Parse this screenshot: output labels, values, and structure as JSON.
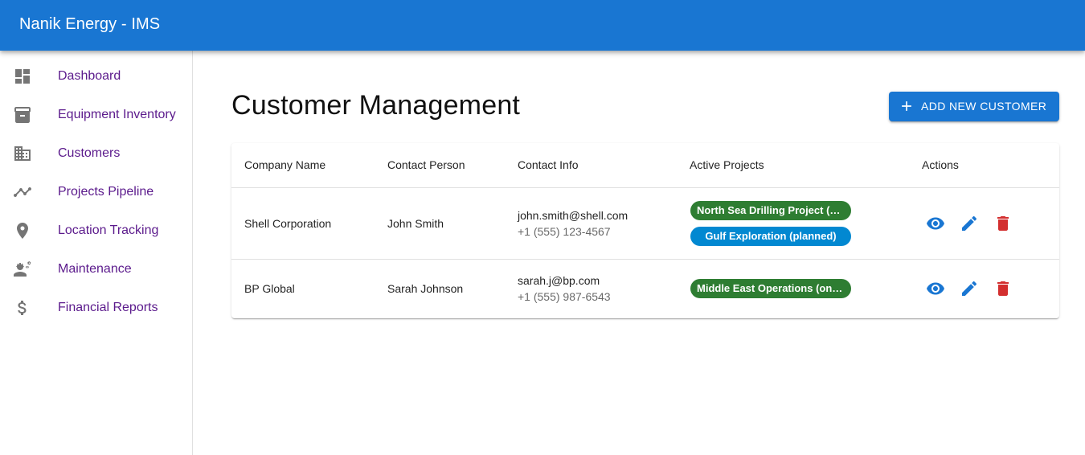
{
  "app": {
    "title": "Nanik Energy - IMS"
  },
  "sidebar": {
    "items": [
      {
        "label": "Dashboard",
        "icon": "dashboard-icon"
      },
      {
        "label": "Equipment Inventory",
        "icon": "inventory-icon"
      },
      {
        "label": "Customers",
        "icon": "business-icon"
      },
      {
        "label": "Projects Pipeline",
        "icon": "timeline-icon"
      },
      {
        "label": "Location Tracking",
        "icon": "location-pin-icon"
      },
      {
        "label": "Maintenance",
        "icon": "engineering-icon"
      },
      {
        "label": "Financial Reports",
        "icon": "dollar-icon"
      }
    ]
  },
  "page": {
    "title": "Customer Management",
    "add_button_label": "ADD NEW CUSTOMER"
  },
  "table": {
    "headers": [
      "Company Name",
      "Contact Person",
      "Contact Info",
      "Active Projects",
      "Actions"
    ],
    "rows": [
      {
        "company": "Shell Corporation",
        "contact": "John Smith",
        "email": "john.smith@shell.com",
        "phone": "+1 (555) 123-4567",
        "projects": [
          {
            "label": "North Sea Drilling Project (ongoing)",
            "status": "ongoing"
          },
          {
            "label": "Gulf Exploration (planned)",
            "status": "planned"
          }
        ]
      },
      {
        "company": "BP Global",
        "contact": "Sarah Johnson",
        "email": "sarah.j@bp.com",
        "phone": "+1 (555) 987-6543",
        "projects": [
          {
            "label": "Middle East Operations (ongoing)",
            "status": "ongoing"
          }
        ]
      }
    ]
  },
  "colors": {
    "primary": "#1976d2",
    "nav_text": "#5b1a8c",
    "ongoing": "#2e7d32",
    "planned": "#0288d1",
    "delete": "#d32f2f"
  }
}
